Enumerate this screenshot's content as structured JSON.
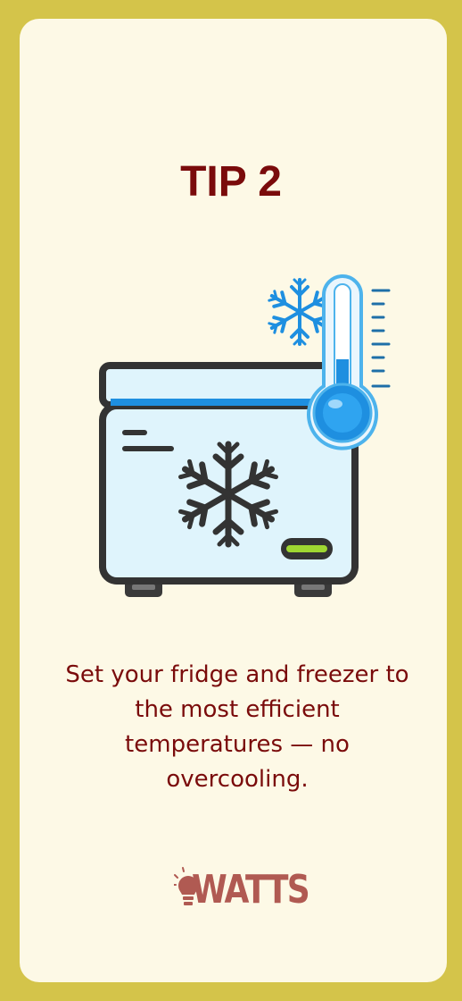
{
  "tip": {
    "title": "TIP 2",
    "text": "Set your fridge and freezer to the most efficient temperatures — no overcooling."
  },
  "brand": {
    "name": "WATTS",
    "icon": "lightbulb-icon"
  },
  "illustration": {
    "subject": "chest-freezer-icon",
    "accents": [
      "snowflake-icon",
      "thermometer-icon"
    ]
  },
  "colors": {
    "background": "#d4c44a",
    "card": "#fdf9e6",
    "title": "#7a0b0b",
    "body_text": "#7a0b0b",
    "brand": "#b05a52",
    "freezer_body": "#dff4fc",
    "freezer_outline": "#333333",
    "accent_blue": "#1e8fe0",
    "indicator_green": "#9ed631"
  }
}
